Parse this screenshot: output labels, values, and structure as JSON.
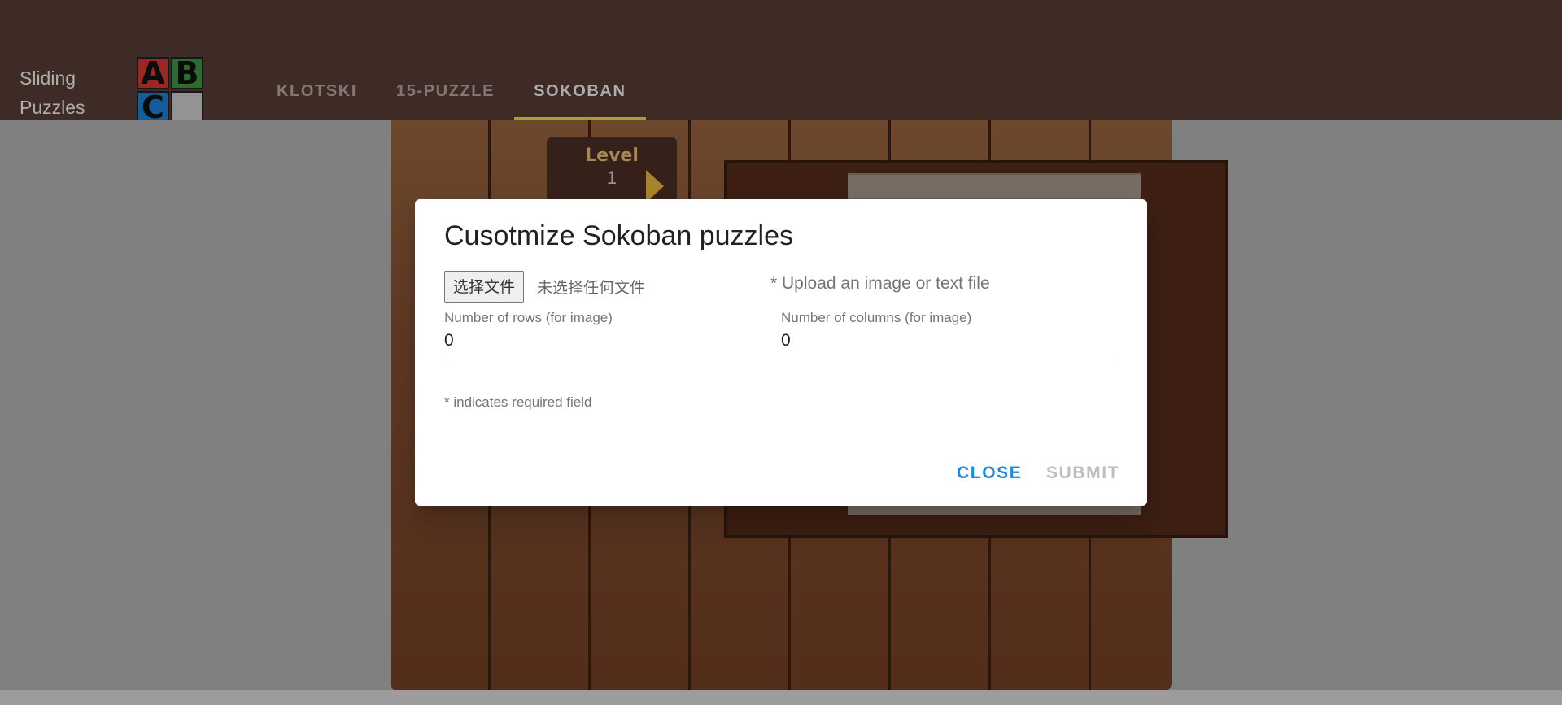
{
  "app": {
    "brand_line1": "Sliding",
    "brand_line2": "Puzzles",
    "logo": [
      "A",
      "B",
      "C",
      ""
    ],
    "colors": {
      "appbar": "#5d4037",
      "tab_indicator": "#ffeb3b",
      "accent": "#1e88e5"
    }
  },
  "tabs": [
    {
      "label": "KLOTSKI"
    },
    {
      "label": "15-PUZZLE"
    },
    {
      "label": "SOKOBAN",
      "active": true
    }
  ],
  "board": {
    "level_label": "Level",
    "level_number": "1"
  },
  "dialog": {
    "title": "Cusotmize Sokoban puzzles",
    "file_button": "选择文件",
    "file_status": "未选择任何文件",
    "upload_label": "* Upload an image or text file",
    "rows_label": "Number of rows (for image)",
    "rows_value": "0",
    "columns_label": "Number of columns (for image)",
    "columns_value": "0",
    "required_note": "* indicates required field",
    "close_label": "CLOSE",
    "submit_label": "SUBMIT"
  }
}
